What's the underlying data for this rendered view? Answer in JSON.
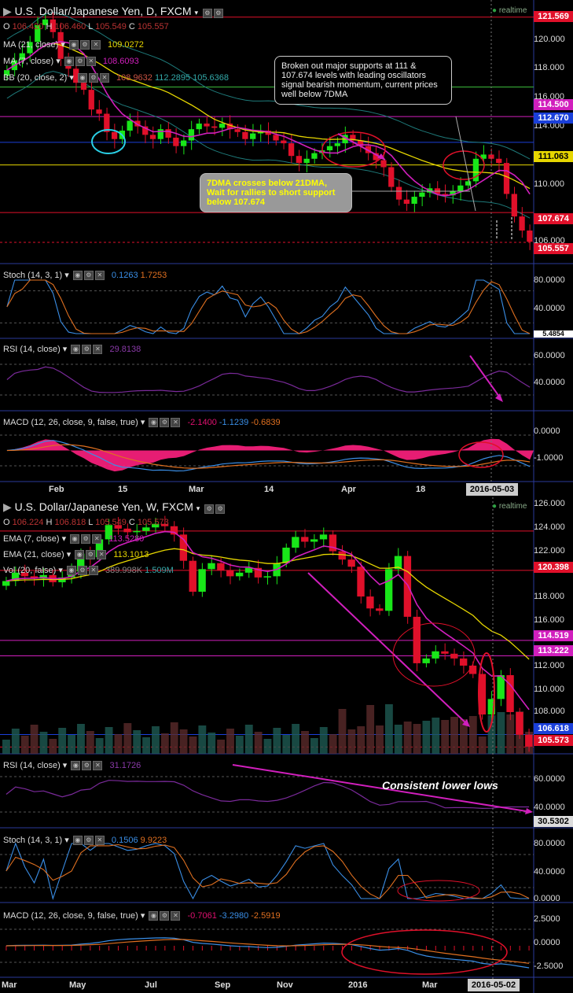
{
  "top": {
    "title": "U.S. Dollar/Japanese Yen, D, FXCM",
    "realtime": "realtime",
    "ohlc": {
      "o": "106.420",
      "h": "106.460",
      "l": "105.549",
      "c": "105.557"
    },
    "ma21": {
      "label": "MA (21, close)",
      "value": "109.0272"
    },
    "ma7": {
      "label": "MA (7, close)",
      "value": "108.6093"
    },
    "bb": {
      "label": "BB (20, close, 2)",
      "v1": "108.9632",
      "v2": "112.2895",
      "v3": "105.6368"
    },
    "price_ticks": [
      "120.000",
      "118.000",
      "116.000",
      "114.000",
      "110.000",
      "106.000"
    ],
    "price_tags": [
      {
        "text": "121.569",
        "color": "#e0102a"
      },
      {
        "text": "114.500",
        "color": "#d11fbd"
      },
      {
        "text": "112.670",
        "color": "#1a3fd9"
      },
      {
        "text": "111.063",
        "color": "#e6d600"
      },
      {
        "text": "107.674",
        "color": "#e0102a"
      },
      {
        "text": "105.557",
        "color": "#e0102a"
      }
    ],
    "annotation1": "Broken out major supports at 111 & 107.674 levels with leading oscillators signal bearish momentum, current prices well below 7DMA",
    "annotation2": "7DMA crosses below 21DMA, Wait for rallies to short support below 107.674",
    "stoch": {
      "label": "Stoch (14, 3, 1)",
      "v1": "0.1263",
      "v2": "1.7253",
      "ticks": [
        "80.0000",
        "40.0000"
      ],
      "tag": "5.4854"
    },
    "rsi": {
      "label": "RSI (14, close)",
      "value": "29.8138",
      "ticks": [
        "60.0000",
        "40.0000"
      ]
    },
    "macd": {
      "label": "MACD (12, 26, close, 9, false, true)",
      "v1": "-2.1400",
      "v2": "-1.1239",
      "v3": "-0.6839",
      "ticks": [
        "0.0000",
        "-1.0000"
      ]
    },
    "xlabels": [
      "Feb",
      "15",
      "Mar",
      "14",
      "Apr",
      "18"
    ],
    "date_tag": "2016-05-03"
  },
  "bottom": {
    "title": "U.S. Dollar/Japanese Yen, W, FXCM",
    "realtime": "realtime",
    "ohlc": {
      "o": "106.224",
      "h": "106.818",
      "l": "105.549",
      "c": "105.573"
    },
    "ema7": {
      "label": "EMA (7, close)",
      "value": "113.5280"
    },
    "ema21": {
      "label": "EMA (21, close)",
      "value": "113.1013"
    },
    "vol": {
      "label": "Vol (20, false)",
      "v1": "389.998K",
      "v2": "1.509M"
    },
    "price_ticks": [
      "126.000",
      "124.000",
      "122.000",
      "118.000",
      "116.000",
      "112.000",
      "110.000",
      "108.000"
    ],
    "price_tags": [
      {
        "text": "120.398",
        "color": "#e0102a"
      },
      {
        "text": "114.519",
        "color": "#d11fbd"
      },
      {
        "text": "113.222",
        "color": "#d11fbd"
      },
      {
        "text": "106.618",
        "color": "#1a3fd9"
      },
      {
        "text": "105.573",
        "color": "#e0102a"
      }
    ],
    "rsi": {
      "label": "RSI (14, close)",
      "value": "31.1726",
      "ticks": [
        "60.0000",
        "40.0000"
      ],
      "tag": "30.5302"
    },
    "annotation": "Consistent lower lows",
    "stoch": {
      "label": "Stoch (14, 3, 1)",
      "v1": "0.1506",
      "v2": "9.9223",
      "ticks": [
        "80.0000",
        "40.0000",
        "0.0000"
      ]
    },
    "macd": {
      "label": "MACD (12, 26, close, 9, false, true)",
      "v1": "-0.7061",
      "v2": "-3.2980",
      "v3": "-2.5919",
      "ticks": [
        "2.5000",
        "0.0000",
        "-2.5000"
      ]
    },
    "xlabels": [
      "Mar",
      "May",
      "Jul",
      "Sep",
      "Nov",
      "2016",
      "Mar"
    ],
    "date_tag": "2016-05-02"
  },
  "chart_data": [
    {
      "type": "candlestick",
      "title": "U.S. Dollar/Japanese Yen, D, FXCM",
      "ylim": [
        105,
        122
      ],
      "closes": [
        117.8,
        118.5,
        119.0,
        119.8,
        121.0,
        121.4,
        120.5,
        118.6,
        117.9,
        116.9,
        116.4,
        115.0,
        114.7,
        113.4,
        112.9,
        113.5,
        114.2,
        113.8,
        113.2,
        112.9,
        113.6,
        113.0,
        112.4,
        112.8,
        113.6,
        114.0,
        113.8,
        113.7,
        114.0,
        113.6,
        113.4,
        112.9,
        113.3,
        113.5,
        113.2,
        112.8,
        112.6,
        111.7,
        111.2,
        111.5,
        111.9,
        112.1,
        112.4,
        112.6,
        113.2,
        112.8,
        112.4,
        111.9,
        111.4,
        110.9,
        109.5,
        108.6,
        108.3,
        108.8,
        109.1,
        109.4,
        109.0,
        108.9,
        109.2,
        109.6,
        109.9,
        111.5,
        111.8,
        111.5,
        111.2,
        109.0,
        107.4,
        106.4,
        105.6
      ],
      "ma7_last": 108.6093,
      "ma21_last": 109.0272
    },
    {
      "type": "candlestick",
      "title": "U.S. Dollar/Japanese Yen, W, FXCM",
      "ylim": [
        105,
        126
      ],
      "closes": [
        119.5,
        120.2,
        119.9,
        119.7,
        120.0,
        119.4,
        119.8,
        120.3,
        121.8,
        121.5,
        123.0,
        124.2,
        123.9,
        123.6,
        123.7,
        124.0,
        124.3,
        124.1,
        123.4,
        121.2,
        118.6,
        120.5,
        121.0,
        120.4,
        119.9,
        120.2,
        120.6,
        119.8,
        119.9,
        121.0,
        122.3,
        123.2,
        122.8,
        123.0,
        123.4,
        122.0,
        121.3,
        120.7,
        118.2,
        117.2,
        117.0,
        120.5,
        121.6,
        116.5,
        112.6,
        113.0,
        113.6,
        113.4,
        113.0,
        112.4,
        111.7,
        108.3,
        109.6,
        111.6,
        108.5,
        106.6,
        105.6
      ],
      "rsi_last": 31.1726
    }
  ]
}
